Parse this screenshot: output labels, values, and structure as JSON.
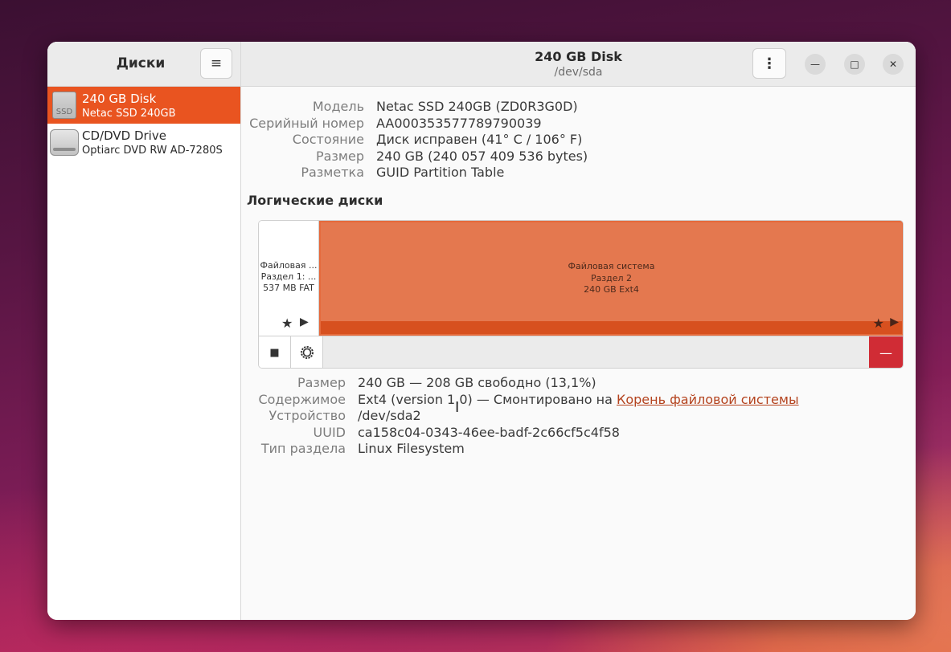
{
  "sidebar": {
    "title": "Диски",
    "drives": [
      {
        "name": "240 GB Disk",
        "subtitle": "Netac SSD 240GB",
        "icon_label": "SSD",
        "icon": "ssd-icon",
        "selected": true
      },
      {
        "name": "CD/DVD Drive",
        "subtitle": "Optiarc DVD RW AD-7280S",
        "icon": "dvd-drive-icon",
        "selected": false
      }
    ]
  },
  "header": {
    "title": "240 GB Disk",
    "subtitle": "/dev/sda",
    "menu_icon": "≡",
    "kebab_icon": "⋮",
    "window_buttons": {
      "minimize": "—",
      "maximize": "□",
      "close": "✕"
    }
  },
  "disk_info": [
    {
      "label": "Модель",
      "value": "Netac SSD 240GB (ZD0R3G0D)"
    },
    {
      "label": "Серийный номер",
      "value": "AA000353577789790039"
    },
    {
      "label": "Состояние",
      "value": "Диск исправен (41° C / 106° F)"
    },
    {
      "label": "Размер",
      "value": "240 GB (240 057 409 536 bytes)"
    },
    {
      "label": "Разметка",
      "value": "GUID Partition Table"
    }
  ],
  "volumes": {
    "title": "Логические диски",
    "partitions": [
      {
        "line1": "Файловая ...",
        "line2": "Раздел 1: ...",
        "line3": "537 MB FAT",
        "selected": false
      },
      {
        "line1": "Файловая система",
        "line2": "Раздел 2",
        "line3": "240 GB Ext4",
        "selected": true
      }
    ],
    "controls": {
      "mount_glyph": "★",
      "play_glyph": "▶",
      "stop_glyph": "■",
      "delete_glyph": "—"
    }
  },
  "partition_info": {
    "size": {
      "label": "Размер",
      "value": "240 GB — 208 GB свободно (13,1%)"
    },
    "contents": {
      "label": "Содержимое",
      "value_prefix": "Ext4 (version 1.0) — Смонтировано на ",
      "link": "Корень файловой системы"
    },
    "device": {
      "label": "Устройство",
      "value": "/dev/sda2"
    },
    "uuid": {
      "label": "UUID",
      "value": "ca158c04-0343-46ee-badf-2c66cf5c4f58"
    },
    "type": {
      "label": "Тип раздела",
      "value": "Linux Filesystem"
    }
  },
  "colors": {
    "accent": "#e95420",
    "partition_fill": "#e4784f",
    "partition_bar": "#d7501f",
    "delete": "#d02c35",
    "link": "#b4431e"
  }
}
